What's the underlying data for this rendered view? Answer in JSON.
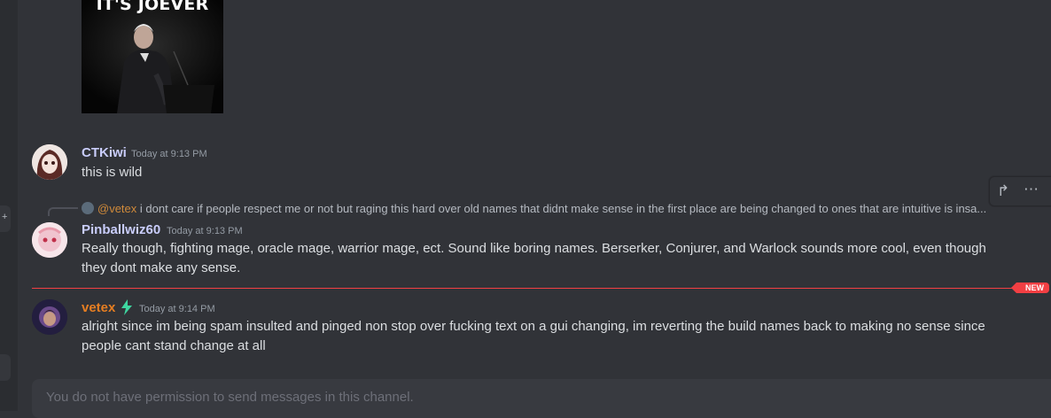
{
  "meme": {
    "caption": "IT'S JOEVER"
  },
  "messages": [
    {
      "username": "CTKiwi",
      "username_color": "#c9cdfb",
      "timestamp": "Today at 9:13 PM",
      "text": "this is wild"
    },
    {
      "username": "Pinballwiz60",
      "username_color": "#c9cdfb",
      "timestamp": "Today at 9:13 PM",
      "reply": {
        "mention": "@vetex",
        "text": "i dont care if people respect me or not but raging this hard over old names that didnt make sense in the first place are being changed to ones that are intuitive is insa..."
      },
      "text": "Really though, fighting mage, oracle mage, warrior mage, ect. Sound like boring names. Berserker, Conjurer, and Warlock sounds more cool, even though they dont make any sense."
    },
    {
      "username": "vetex",
      "username_color": "#e67e22",
      "timestamp": "Today at 9:14 PM",
      "text": "alright since im being spam insulted and pinged non stop over fucking text on a gui changing, im reverting the build names back to making no sense since people cant stand change at all"
    }
  ],
  "divider": {
    "label": "NEW"
  },
  "toolbar": {
    "forward_icon": "forward-arrow-icon",
    "more_icon": "more-dots-icon"
  },
  "composer": {
    "placeholder": "You do not have permission to send messages in this channel."
  },
  "colors": {
    "background": "#313338",
    "new_divider": "#f23f43",
    "vetex_badge": "#3ed6a0"
  }
}
